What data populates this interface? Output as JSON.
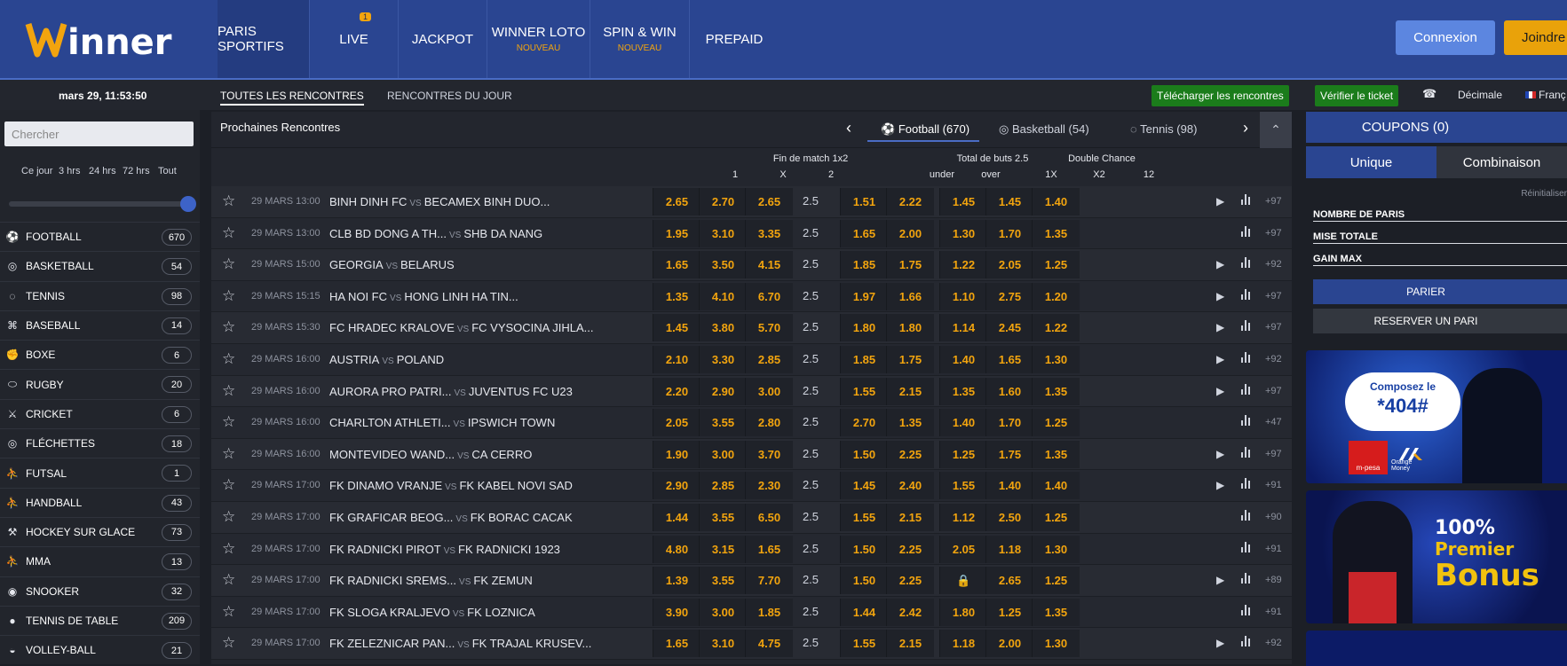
{
  "header": {
    "logo": "Winner",
    "nav": [
      {
        "label": "PARIS SPORTIFS",
        "sub": "",
        "badge": ""
      },
      {
        "label": "LIVE",
        "sub": "",
        "badge": "1"
      },
      {
        "label": "JACKPOT",
        "sub": "",
        "badge": ""
      },
      {
        "label": "WINNER LOTO",
        "sub": "NOUVEAU",
        "badge": ""
      },
      {
        "label": "SPIN & WIN",
        "sub": "NOUVEAU",
        "badge": ""
      },
      {
        "label": "PREPAID",
        "sub": "",
        "badge": ""
      }
    ],
    "login": "Connexion",
    "join": "Joindre"
  },
  "subbar": {
    "clock": "mars 29, 11:53:50",
    "tab_all": "TOUTES LES RENCONTRES",
    "tab_today": "RENCONTRES DU JOUR",
    "download": "Télécharger les rencontres",
    "verify": "Vérifier le ticket",
    "odds_format": "Décimale",
    "language": "Franç"
  },
  "sidebar": {
    "search_placeholder": "Chercher",
    "periods": [
      "Ce jour",
      "3 hrs",
      "24 hrs",
      "72 hrs",
      "Tout"
    ],
    "sports": [
      {
        "name": "FOOTBALL",
        "count": "670",
        "icon": "football-icon"
      },
      {
        "name": "BASKETBALL",
        "count": "54",
        "icon": "basketball-icon"
      },
      {
        "name": "TENNIS",
        "count": "98",
        "icon": "tennis-icon"
      },
      {
        "name": "BASEBALL",
        "count": "14",
        "icon": "baseball-icon"
      },
      {
        "name": "BOXE",
        "count": "6",
        "icon": "boxing-icon"
      },
      {
        "name": "RUGBY",
        "count": "20",
        "icon": "rugby-icon"
      },
      {
        "name": "CRICKET",
        "count": "6",
        "icon": "cricket-icon"
      },
      {
        "name": "FLÉCHETTES",
        "count": "18",
        "icon": "darts-icon"
      },
      {
        "name": "FUTSAL",
        "count": "1",
        "icon": "futsal-icon"
      },
      {
        "name": "HANDBALL",
        "count": "43",
        "icon": "handball-icon"
      },
      {
        "name": "HOCKEY SUR GLACE",
        "count": "73",
        "icon": "hockey-icon"
      },
      {
        "name": "MMA",
        "count": "13",
        "icon": "mma-icon"
      },
      {
        "name": "SNOOKER",
        "count": "32",
        "icon": "snooker-icon"
      },
      {
        "name": "TENNIS DE TABLE",
        "count": "209",
        "icon": "table-tennis-icon"
      },
      {
        "name": "VOLLEY-BALL",
        "count": "21",
        "icon": "volleyball-icon"
      }
    ]
  },
  "main": {
    "title": "Prochaines Rencontres",
    "sport_tabs": [
      "Football (670)",
      "Basketball (54)",
      "Tennis (98)"
    ],
    "groups": {
      "match_result": "Fin de match 1x2",
      "total_goals": "Total de buts 2.5",
      "double_chance": "Double Chance"
    },
    "cols": {
      "c1": "1",
      "cx": "X",
      "c2": "2",
      "under": "under",
      "over": "over",
      "c1x": "1X",
      "cx2": "X2",
      "c12": "12"
    },
    "vs": "VS",
    "matches": [
      {
        "date": "29 MARS 13:00",
        "home": "BINH DINH FC",
        "away": "BECAMEX BINH DUO...",
        "o1": "2.65",
        "ox": "2.70",
        "o2": "2.65",
        "line": "2.5",
        "under": "1.51",
        "over": "2.22",
        "d1x": "1.45",
        "dx2": "1.45",
        "d12": "1.40",
        "more": "+97",
        "play": "▶"
      },
      {
        "date": "29 MARS 13:00",
        "home": "CLB BD DONG A TH...",
        "away": "SHB DA NANG",
        "o1": "1.95",
        "ox": "3.10",
        "o2": "3.35",
        "line": "2.5",
        "under": "1.65",
        "over": "2.00",
        "d1x": "1.30",
        "dx2": "1.70",
        "d12": "1.35",
        "more": "+97",
        "play": ""
      },
      {
        "date": "29 MARS 15:00",
        "home": "GEORGIA",
        "away": "BELARUS",
        "o1": "1.65",
        "ox": "3.50",
        "o2": "4.15",
        "line": "2.5",
        "under": "1.85",
        "over": "1.75",
        "d1x": "1.22",
        "dx2": "2.05",
        "d12": "1.25",
        "more": "+92",
        "play": "▶"
      },
      {
        "date": "29 MARS 15:15",
        "home": "HA NOI FC",
        "away": "HONG LINH HA TIN...",
        "o1": "1.35",
        "ox": "4.10",
        "o2": "6.70",
        "line": "2.5",
        "under": "1.97",
        "over": "1.66",
        "d1x": "1.10",
        "dx2": "2.75",
        "d12": "1.20",
        "more": "+97",
        "play": "▶"
      },
      {
        "date": "29 MARS 15:30",
        "home": "FC HRADEC KRALOVE",
        "away": "FC VYSOCINA JIHLA...",
        "o1": "1.45",
        "ox": "3.80",
        "o2": "5.70",
        "line": "2.5",
        "under": "1.80",
        "over": "1.80",
        "d1x": "1.14",
        "dx2": "2.45",
        "d12": "1.22",
        "more": "+97",
        "play": "▶"
      },
      {
        "date": "29 MARS 16:00",
        "home": "AUSTRIA",
        "away": "POLAND",
        "o1": "2.10",
        "ox": "3.30",
        "o2": "2.85",
        "line": "2.5",
        "under": "1.85",
        "over": "1.75",
        "d1x": "1.40",
        "dx2": "1.65",
        "d12": "1.30",
        "more": "+92",
        "play": "▶"
      },
      {
        "date": "29 MARS 16:00",
        "home": "AURORA PRO PATRI...",
        "away": "JUVENTUS FC U23",
        "o1": "2.20",
        "ox": "2.90",
        "o2": "3.00",
        "line": "2.5",
        "under": "1.55",
        "over": "2.15",
        "d1x": "1.35",
        "dx2": "1.60",
        "d12": "1.35",
        "more": "+97",
        "play": "▶"
      },
      {
        "date": "29 MARS 16:00",
        "home": "CHARLTON ATHLETI...",
        "away": "IPSWICH TOWN",
        "o1": "2.05",
        "ox": "3.55",
        "o2": "2.80",
        "line": "2.5",
        "under": "2.70",
        "over": "1.35",
        "d1x": "1.40",
        "dx2": "1.70",
        "d12": "1.25",
        "more": "+47",
        "play": ""
      },
      {
        "date": "29 MARS 16:00",
        "home": "MONTEVIDEO WAND...",
        "away": "CA CERRO",
        "o1": "1.90",
        "ox": "3.00",
        "o2": "3.70",
        "line": "2.5",
        "under": "1.50",
        "over": "2.25",
        "d1x": "1.25",
        "dx2": "1.75",
        "d12": "1.35",
        "more": "+97",
        "play": "▶"
      },
      {
        "date": "29 MARS 17:00",
        "home": "FK DINAMO VRANJE",
        "away": "FK KABEL NOVI SAD",
        "o1": "2.90",
        "ox": "2.85",
        "o2": "2.30",
        "line": "2.5",
        "under": "1.45",
        "over": "2.40",
        "d1x": "1.55",
        "dx2": "1.40",
        "d12": "1.40",
        "more": "+91",
        "play": "▶"
      },
      {
        "date": "29 MARS 17:00",
        "home": "FK GRAFICAR BEOG...",
        "away": "FK BORAC CACAK",
        "o1": "1.44",
        "ox": "3.55",
        "o2": "6.50",
        "line": "2.5",
        "under": "1.55",
        "over": "2.15",
        "d1x": "1.12",
        "dx2": "2.50",
        "d12": "1.25",
        "more": "+90",
        "play": ""
      },
      {
        "date": "29 MARS 17:00",
        "home": "FK RADNICKI PIROT",
        "away": "FK RADNICKI 1923",
        "o1": "4.80",
        "ox": "3.15",
        "o2": "1.65",
        "line": "2.5",
        "under": "1.50",
        "over": "2.25",
        "d1x": "2.05",
        "dx2": "1.18",
        "d12": "1.30",
        "more": "+91",
        "play": ""
      },
      {
        "date": "29 MARS 17:00",
        "home": "FK RADNICKI SREMS...",
        "away": "FK ZEMUN",
        "o1": "1.39",
        "ox": "3.55",
        "o2": "7.70",
        "line": "2.5",
        "under": "1.50",
        "over": "2.25",
        "d1x": "",
        "dx2": "2.65",
        "d12": "1.25",
        "more": "+89",
        "play": "▶"
      },
      {
        "date": "29 MARS 17:00",
        "home": "FK SLOGA KRALJEVO",
        "away": "FK LOZNICA",
        "o1": "3.90",
        "ox": "3.00",
        "o2": "1.85",
        "line": "2.5",
        "under": "1.44",
        "over": "2.42",
        "d1x": "1.80",
        "dx2": "1.25",
        "d12": "1.35",
        "more": "+91",
        "play": ""
      },
      {
        "date": "29 MARS 17:00",
        "home": "FK ZELEZNICAR PAN...",
        "away": "FK TRAJAL KRUSEV...",
        "o1": "1.65",
        "ox": "3.10",
        "o2": "4.75",
        "line": "2.5",
        "under": "1.55",
        "over": "2.15",
        "d1x": "1.18",
        "dx2": "2.00",
        "d12": "1.30",
        "more": "+92",
        "play": "▶"
      }
    ]
  },
  "coupon": {
    "title": "COUPONS (0)",
    "tab_single": "Unique",
    "tab_combo": "Combinaison",
    "reset": "Réinitialiser",
    "bets_count": "NOMBRE DE PARIS",
    "total_stake": "MISE TOTALE",
    "max_win": "GAIN MAX",
    "place_bet": "PARIER",
    "reserve_bet": "RESERVER UN PARI"
  },
  "banners": {
    "ussd_prefix": "Composez le",
    "ussd_code": "*404#",
    "mpesa": "m-pesa",
    "orange": "Orange Money",
    "bonus_pct": "100%",
    "bonus_word": "Premier",
    "bonus_title": "Bonus"
  },
  "colors": {
    "brand_blue": "#2a4591",
    "odds": "#f2a40e",
    "green": "#1b7c1b"
  }
}
